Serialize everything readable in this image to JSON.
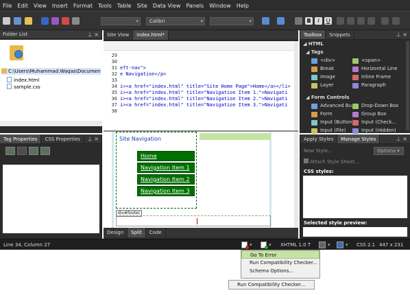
{
  "menu": [
    "File",
    "Edit",
    "View",
    "Insert",
    "Format",
    "Tools",
    "Table",
    "Site",
    "Data View",
    "Panels",
    "Window",
    "Help"
  ],
  "toolbar": {
    "font_combo": "Calibri"
  },
  "folder_list": {
    "title": "Folder List",
    "path": "C:\\Users\\Muhammad.Waqas\\Documents\\M",
    "files": [
      "index.html",
      "sample.css"
    ]
  },
  "editor": {
    "tabs": [
      "Site View",
      "index.html*"
    ],
    "line_numbers": [
      "29",
      "30",
      "31",
      "32",
      "33",
      "34",
      "35",
      "36",
      "37",
      "38"
    ],
    "code_lines": [
      "",
      "",
      "eft-nav\">",
      "e Navigation</p>",
      "",
      "i><a href=\"index.html\" title=\"Site Home Page\">Home</a></li>",
      "i><a href=\"index.html\" title=\"Navigation Item 1.\">Navigati",
      "i><a href=\"index.html\" title=\"Navigation Item 2.\">Navigati",
      "i><a href=\"index.html\" title=\"Navigation Item 3.\">Navigati",
      ""
    ],
    "design": {
      "heading": "Site Navigation",
      "nav_items": [
        "Home",
        "Navigation Item 1",
        "Navigation Item 2",
        "Navigation Item 3"
      ],
      "footer_tag": "div#footer"
    },
    "view_tabs": [
      "Design",
      "Split",
      "Code"
    ]
  },
  "tag_properties": {
    "tabs": [
      "Tag Properties",
      "CSS Properties"
    ]
  },
  "toolbox": {
    "tabs": [
      "Toolbox",
      "Snippets"
    ],
    "section_html": "HTML",
    "section_tags": "Tags",
    "tags": [
      {
        "label": "<div>",
        "icon": "div-icon"
      },
      {
        "label": "<span>",
        "icon": "span-icon"
      },
      {
        "label": "Break",
        "icon": "break-icon"
      },
      {
        "label": "Horizontal Line",
        "icon": "horizontal-line-icon"
      },
      {
        "label": "Image",
        "icon": "image-icon"
      },
      {
        "label": "Inline Frame",
        "icon": "inline-frame-icon"
      },
      {
        "label": "Layer",
        "icon": "layer-icon"
      },
      {
        "label": "Paragraph",
        "icon": "paragraph-icon"
      }
    ],
    "section_forms": "Form Controls",
    "forms": [
      {
        "label": "Advanced Bu...",
        "icon": "advanced-button-icon"
      },
      {
        "label": "Drop-Down Box",
        "icon": "dropdown-box-icon"
      },
      {
        "label": "Form",
        "icon": "form-icon"
      },
      {
        "label": "Group Box",
        "icon": "group-box-icon"
      },
      {
        "label": "Input (Button)",
        "icon": "input-button-icon"
      },
      {
        "label": "Input (Check...",
        "icon": "input-checkbox-icon"
      },
      {
        "label": "Input (File)",
        "icon": "input-file-icon"
      },
      {
        "label": "Input (Hidden)",
        "icon": "input-hidden-icon"
      }
    ]
  },
  "styles": {
    "tabs": [
      "Apply Styles",
      "Manage Styles"
    ],
    "new_style": "New Style...",
    "options": "Options",
    "attach": "Attach Style Sheet...",
    "css_styles": "CSS styles:",
    "preview": "Selected style preview:"
  },
  "status": {
    "position": "Line 34, Column 27",
    "doctype": "XHTML 1.0 T",
    "css": "CSS 2.1",
    "size": "447 x 231"
  },
  "context_menu": {
    "items": [
      "Go To Error",
      "Run Compatibility Checker...",
      "Schema Options..."
    ],
    "lower_item": "Run Compatibility Checker..."
  },
  "colors": {
    "accent": "#c6e3a6",
    "nav_green": "#006f00",
    "code_blue": "#0000c0"
  }
}
